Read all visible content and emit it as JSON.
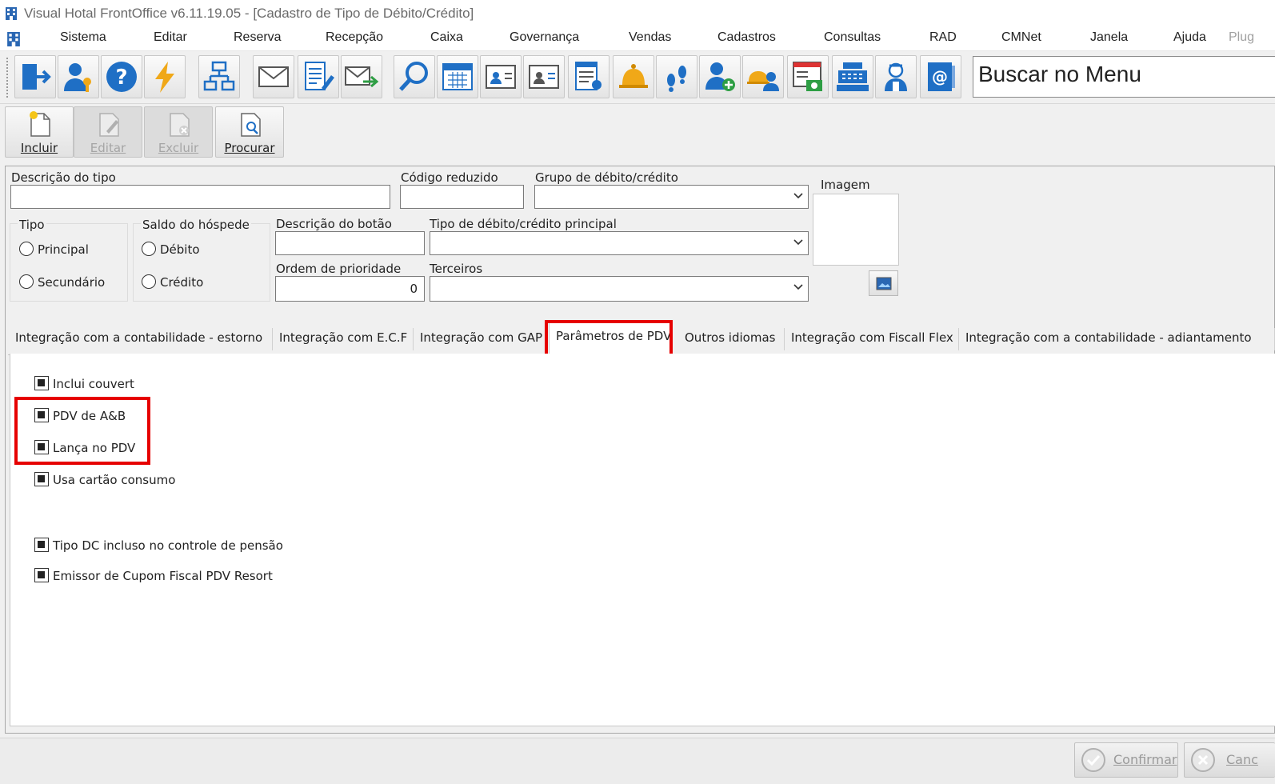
{
  "window": {
    "title": "Visual Hotal FrontOffice v6.11.19.05 - [Cadastro de Tipo de Débito/Crédito]"
  },
  "menu": {
    "items": [
      "Sistema",
      "Editar",
      "Reserva",
      "Recepção",
      "Caixa",
      "Governança",
      "Vendas",
      "Cadastros",
      "Consultas",
      "RAD",
      "CMNet",
      "Janela",
      "Ajuda",
      "Plug"
    ]
  },
  "toolbar": {
    "icons": [
      "exit-icon",
      "user-key-icon",
      "help-icon",
      "lightning-icon",
      "network-icon",
      "mail-icon",
      "edit-document-icon",
      "send-mail-icon",
      "search-icon",
      "calendar-icon",
      "card-icon",
      "id-card-icon",
      "report-icon",
      "bell-icon",
      "footprints-icon",
      "add-user-icon",
      "room-service-icon",
      "invoice-icon",
      "cash-register-icon",
      "housekeeper-icon",
      "email-book-icon"
    ],
    "search_menu": "Buscar no Menu"
  },
  "actions": {
    "incluir": "Incluir",
    "editar": "Editar",
    "excluir": "Excluir",
    "procurar": "Procurar"
  },
  "form": {
    "descricao_tipo_label": "Descrição do tipo",
    "descricao_tipo_value": "",
    "codigo_reduzido_label": "Código reduzido",
    "codigo_reduzido_value": "",
    "grupo_label": "Grupo de débito/crédito",
    "grupo_value": "",
    "imagem_label": "Imagem",
    "tipo_label": "Tipo",
    "tipo_options": [
      "Principal",
      "Secundário"
    ],
    "saldo_label": "Saldo do hóspede",
    "saldo_options": [
      "Débito",
      "Crédito"
    ],
    "descricao_botao_label": "Descrição do botão",
    "descricao_botao_value": "",
    "tipo_principal_label": "Tipo de débito/crédito principal",
    "tipo_principal_value": "",
    "ordem_label": "Ordem de prioridade",
    "ordem_value": "0",
    "terceiros_label": "Terceiros",
    "terceiros_value": ""
  },
  "tabs": [
    "Integração com a contabilidade - estorno",
    "Integração com E.C.F",
    "Integração com GAP",
    "Parâmetros de PDV",
    "Outros idiomas",
    "Integração com Fiscall Flex",
    "Integração com a contabilidade - adiantamento"
  ],
  "active_tab": "Parâmetros de PDV",
  "pdv_params": [
    {
      "label": "Inclui couvert",
      "checked": true
    },
    {
      "label": "PDV de A&B",
      "checked": true
    },
    {
      "label": "Lança no PDV",
      "checked": true
    },
    {
      "label": "Usa cartão consumo",
      "checked": true
    },
    {
      "label": "Tipo DC incluso no controle de pensão",
      "checked": true
    },
    {
      "label": "Emissor de Cupom Fiscal PDV Resort",
      "checked": true
    }
  ],
  "footer": {
    "confirmar": "Confirmar",
    "cancelar": "Canc"
  },
  "colors": {
    "highlight": "#e60000",
    "toolbar_blue": "#1f6fc5"
  }
}
